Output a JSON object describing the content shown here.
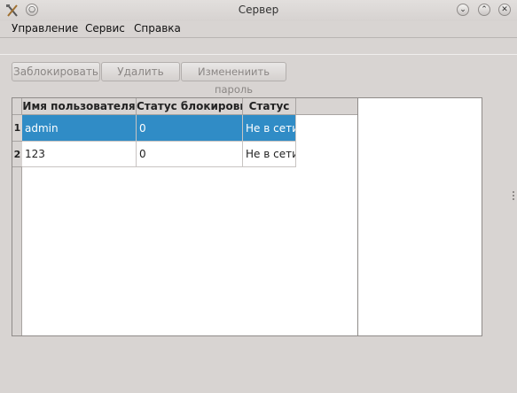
{
  "window": {
    "title": "Сервер"
  },
  "menu": {
    "items": [
      "Управление",
      "Сервис",
      "Справка"
    ]
  },
  "toolbar": {
    "lock_label": "Заблокировать",
    "delete_label": "Удалить",
    "change_password_label": "Изменениить пароль"
  },
  "table": {
    "columns": [
      "Имя пользователя",
      "Статус блокировки",
      "Статус"
    ],
    "row_numbers": [
      "1",
      "2"
    ],
    "rows": [
      [
        "admin",
        "0",
        "Не в сети"
      ],
      [
        "123",
        "0",
        "Не в сети"
      ]
    ],
    "selected_row": 1
  },
  "colors": {
    "selection": "#308cc6",
    "window_bg": "#d8d4d2"
  }
}
